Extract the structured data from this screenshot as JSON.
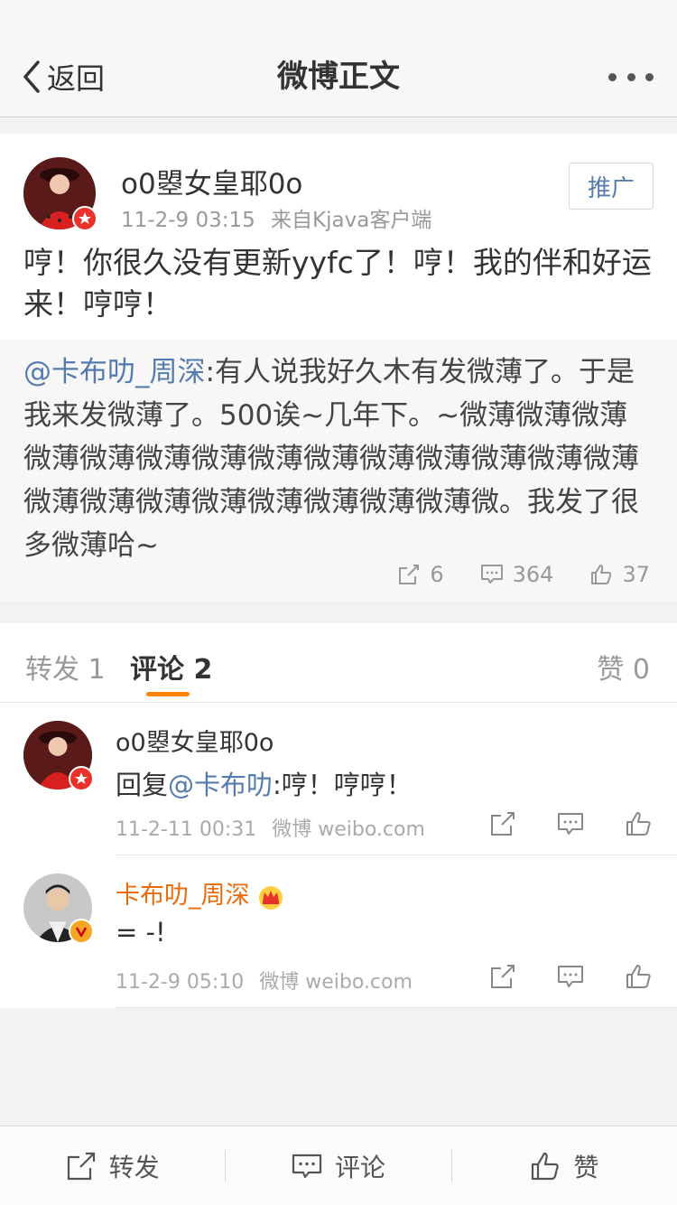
{
  "nav": {
    "back_label": "返回",
    "title": "微博正文"
  },
  "post": {
    "author": "o0曌女皇耶0o",
    "time": "11-2-9 03:15",
    "source": "来自Kjava客户端",
    "promote_label": "推广",
    "text": "哼！你很久没有更新yyfc了！哼！我的伴和好运来！哼哼！",
    "repost": {
      "mention": "@卡布叻_周深",
      "text": ":有人说我好久木有发微薄了。于是我来发微薄了。500诶~几年下。~微薄微薄微薄微薄微薄微薄微薄微薄微薄微薄微薄微薄微薄微薄微薄微薄微薄微薄微薄微薄微薄微薄微。我发了很多微薄哈~",
      "repost_count": "6",
      "comment_count": "364",
      "like_count": "37"
    }
  },
  "tabs": {
    "repost": "转发 1",
    "comment": "评论 2",
    "like": "赞 0"
  },
  "comments": [
    {
      "name": "o0曌女皇耶0o",
      "reply_prefix": "回复",
      "mention": "@卡布叻",
      "text": ":哼！哼哼！",
      "time": "11-2-11 00:31",
      "source": "微博 weibo.com"
    },
    {
      "name": "卡布叻_周深",
      "text": "= -!",
      "time": "11-2-9 05:10",
      "source": "微博 weibo.com"
    }
  ],
  "toolbar": {
    "repost_label": "转发",
    "comment_label": "评论",
    "like_label": "赞"
  },
  "colors": {
    "link": "#557cad",
    "accent": "#ff8200",
    "vip_name": "#e86b0c"
  }
}
